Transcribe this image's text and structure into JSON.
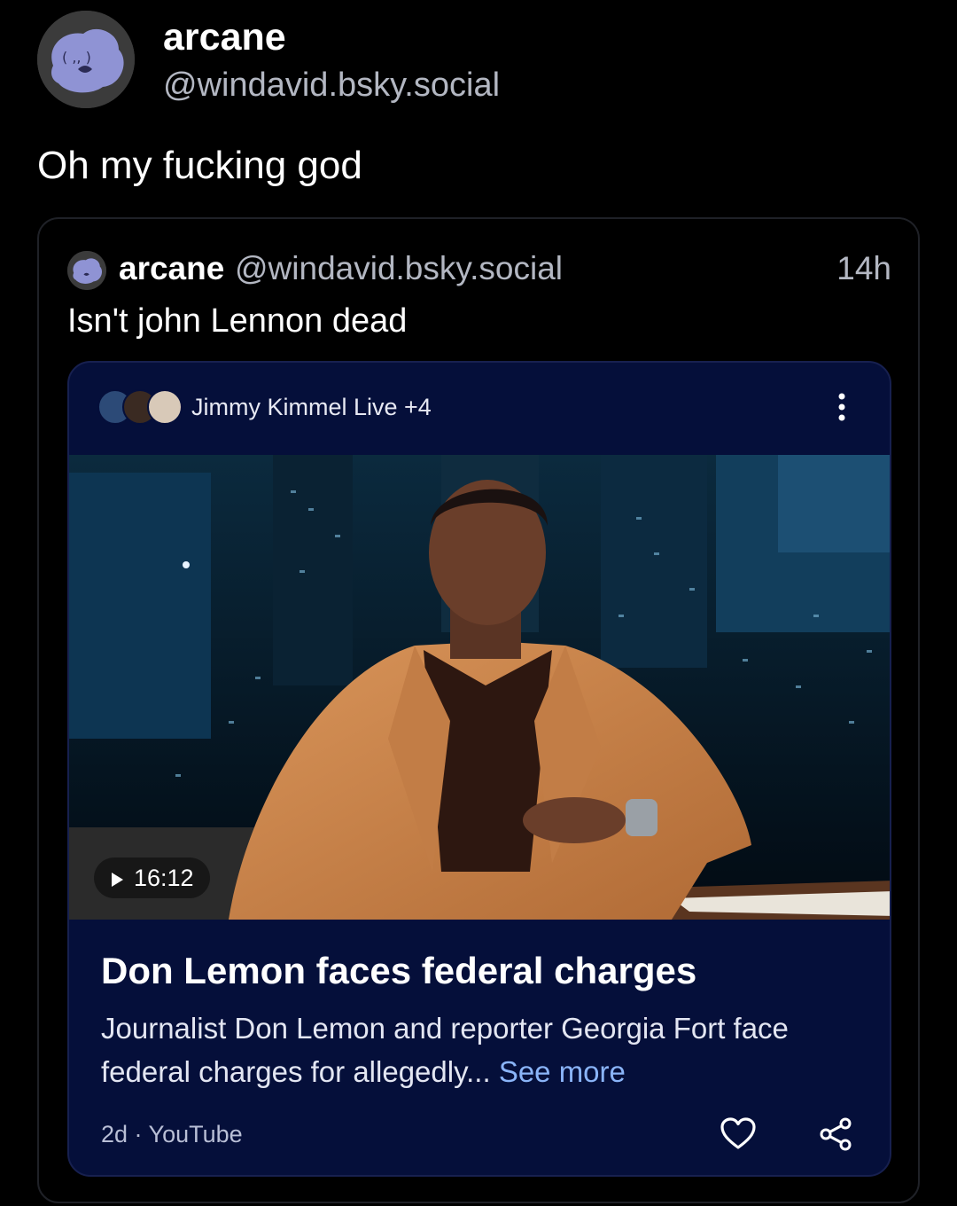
{
  "post": {
    "author": {
      "display_name": "arcane",
      "handle": "@windavid.bsky.social",
      "avatar_icon": "blob-face-avatar"
    },
    "text": "Oh my fucking god"
  },
  "quoted_post": {
    "author": {
      "display_name": "arcane",
      "handle": "@windavid.bsky.social",
      "avatar_icon": "blob-face-avatar"
    },
    "time": "14h",
    "text": "Isn't john Lennon dead",
    "embed": {
      "channel": "Jimmy Kimmel Live +4",
      "duration": "16:12",
      "title": "Don Lemon faces federal charges",
      "description": "Journalist Don Lemon and reporter Georgia Fort face federal charges for allegedly...",
      "see_more": "See more",
      "meta": "2d · YouTube",
      "icons": [
        "more-vertical-icon",
        "play-icon",
        "heart-icon",
        "share-icon"
      ],
      "colors": {
        "card_background": "#050f3a",
        "link": "#8ab4f8"
      }
    }
  }
}
